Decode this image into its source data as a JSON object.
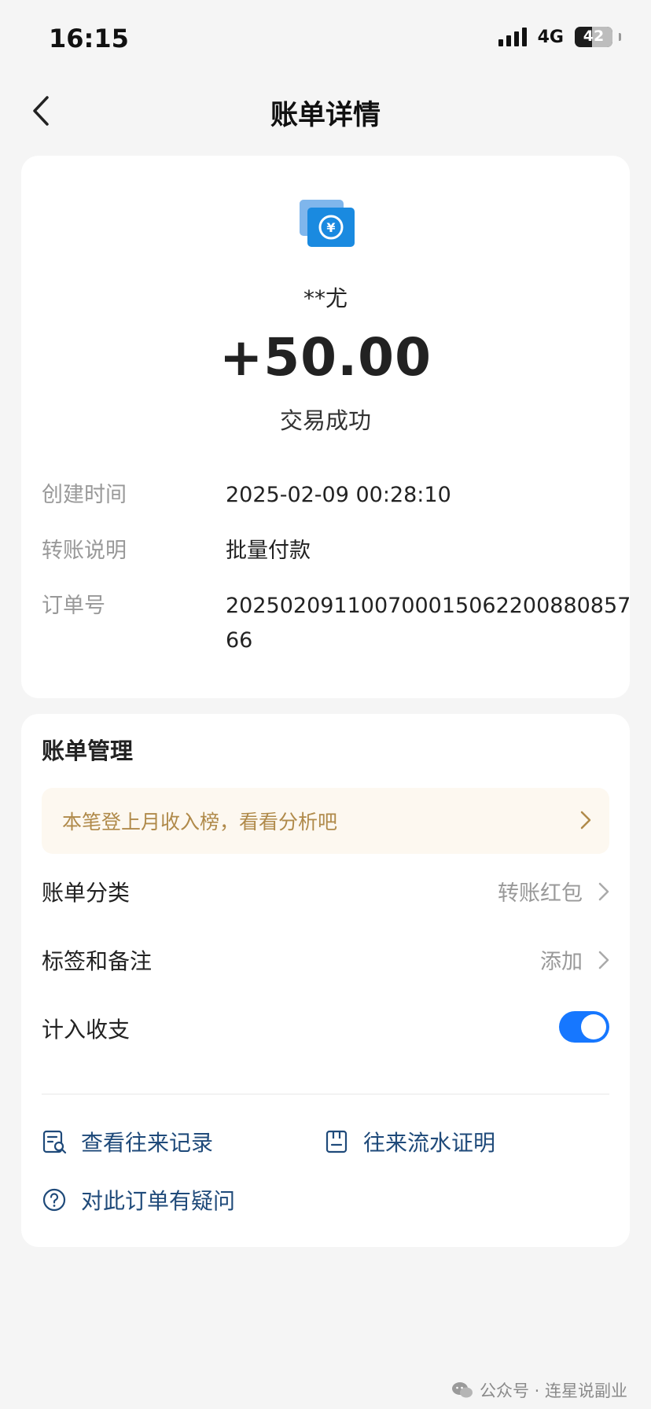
{
  "status_bar": {
    "time": "16:15",
    "network": "4G",
    "battery": "42"
  },
  "nav": {
    "title": "账单详情"
  },
  "transaction": {
    "icon": "transfer-money-icon",
    "payer": "**尤",
    "amount": "+50.00",
    "status": "交易成功",
    "details": {
      "time_label": "创建时间",
      "time_value": "2025-02-09 00:28:10",
      "desc_label": "转账说明",
      "desc_value": "批量付款",
      "order_label": "订单号",
      "order_value": "20250209110070001506220088085766"
    }
  },
  "manage": {
    "title": "账单管理",
    "banner_text": "本笔登上月收入榜，看看分析吧",
    "category_label": "账单分类",
    "category_value": "转账红包",
    "tags_label": "标签和备注",
    "tags_value": "添加",
    "include_label": "计入收支",
    "include_on": true,
    "link_records": "查看往来记录",
    "link_proof": "往来流水证明",
    "link_question": "对此订单有疑问"
  },
  "watermark": {
    "text": "公众号 · 连星说副业"
  },
  "colors": {
    "accent": "#1677ff",
    "link": "#1f4a7a",
    "banner_bg": "#fdf8f0",
    "banner_text": "#b08a4a",
    "page_bg": "#f5f5f5"
  }
}
